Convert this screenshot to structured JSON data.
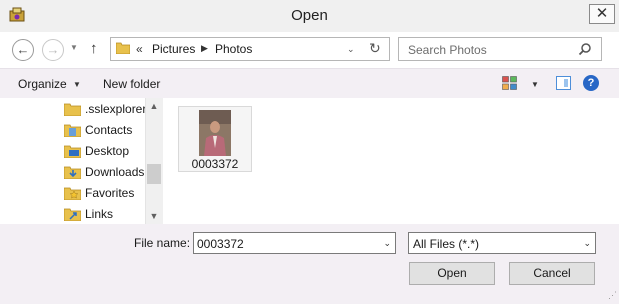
{
  "window": {
    "title": "Open",
    "close": "✕"
  },
  "nav": {
    "back": "←",
    "forward": "→",
    "dropdown": "▼",
    "up": "↑"
  },
  "address": {
    "chevron": "«",
    "segments": [
      "Pictures",
      "Photos"
    ],
    "separator": "▶",
    "dropdown": "⌄",
    "refresh": "↻"
  },
  "search": {
    "placeholder": "Search Photos"
  },
  "toolbar": {
    "organize": "Organize",
    "organize_arrow": "▼",
    "new_folder": "New folder",
    "view_arrow": "▼",
    "help": "?"
  },
  "tree": {
    "items": [
      {
        "label": ".sslexplorer",
        "icon": "folder-icon"
      },
      {
        "label": "Contacts",
        "icon": "contacts-folder-icon"
      },
      {
        "label": "Desktop",
        "icon": "desktop-folder-icon"
      },
      {
        "label": "Downloads",
        "icon": "downloads-folder-icon"
      },
      {
        "label": "Favorites",
        "icon": "favorites-folder-icon"
      },
      {
        "label": "Links",
        "icon": "links-folder-icon"
      }
    ],
    "scroll_up": "▲",
    "scroll_down": "▼"
  },
  "files": [
    {
      "name": "0003372",
      "icon": "photo-thumbnail"
    }
  ],
  "bottom": {
    "file_name_label": "File name:",
    "file_name_value": "0003372",
    "file_type_value": "All Files (*.*)",
    "dropdown": "⌄",
    "open": "Open",
    "cancel": "Cancel",
    "grip": "⋰"
  },
  "colors": {
    "toolbar_bg": "#f3eff4",
    "folder": "#e8c14c",
    "accent": "#2867c6"
  }
}
